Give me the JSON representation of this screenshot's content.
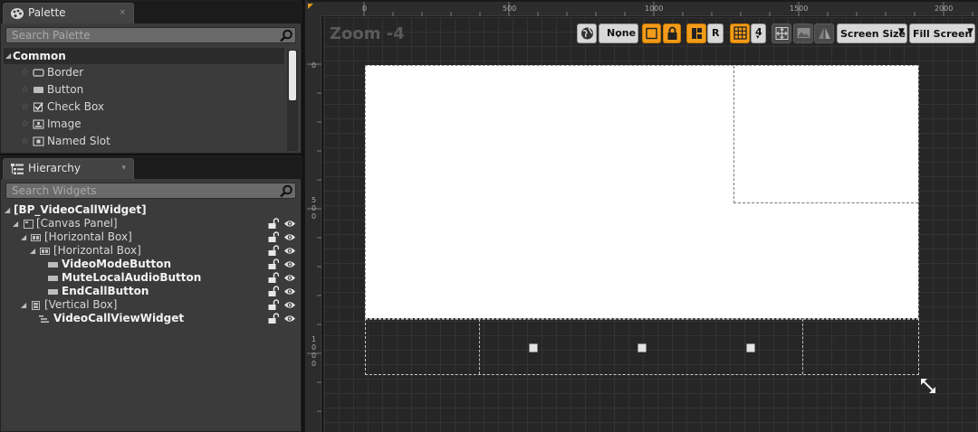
{
  "palette": {
    "tab_title": "Palette",
    "tab_close": "×",
    "search_placeholder": "Search Palette",
    "section": "Common",
    "items": [
      {
        "label": "Border",
        "icon": "border-icon"
      },
      {
        "label": "Button",
        "icon": "button-icon"
      },
      {
        "label": "Check Box",
        "icon": "checkbox-icon"
      },
      {
        "label": "Image",
        "icon": "image-icon"
      },
      {
        "label": "Named Slot",
        "icon": "named-slot-icon"
      }
    ]
  },
  "hierarchy": {
    "tab_title": "Hierarchy",
    "tab_close": "▾",
    "search_placeholder": "Search Widgets",
    "items": [
      {
        "label": "[BP_VideoCallWidget]",
        "bold": true,
        "depth": 0
      },
      {
        "label": "[Canvas Panel]",
        "bold": false,
        "depth": 1
      },
      {
        "label": "[Horizontal Box]",
        "bold": false,
        "depth": 2
      },
      {
        "label": "[Horizontal Box]",
        "bold": false,
        "depth": 3
      },
      {
        "label": "VideoModeButton",
        "bold": true,
        "depth": 4
      },
      {
        "label": "MuteLocalAudioButton",
        "bold": true,
        "depth": 4
      },
      {
        "label": "EndCallButton",
        "bold": true,
        "depth": 4
      },
      {
        "label": "[Vertical Box]",
        "bold": false,
        "depth": 2
      },
      {
        "label": "VideoCallViewWidget",
        "bold": true,
        "depth": 3
      }
    ]
  },
  "designer": {
    "zoom_label": "Zoom -4",
    "ruler_top": [
      "0",
      "500",
      "1000",
      "1500",
      "2000"
    ],
    "ruler_left_0": "0",
    "ruler_left_500": [
      "5",
      "0",
      "0"
    ],
    "ruler_left_1000": [
      "1",
      "0",
      "0",
      "0"
    ],
    "toolbar": {
      "none_label": "None",
      "r_label": "R",
      "grid_size": "4",
      "screen_size_label": "Screen Size",
      "fill_screen_label": "Fill Screen"
    },
    "colors": {
      "accent_orange": "#f29b19",
      "canvas_bg": "#262626",
      "widget_fill": "#ffffff"
    }
  }
}
